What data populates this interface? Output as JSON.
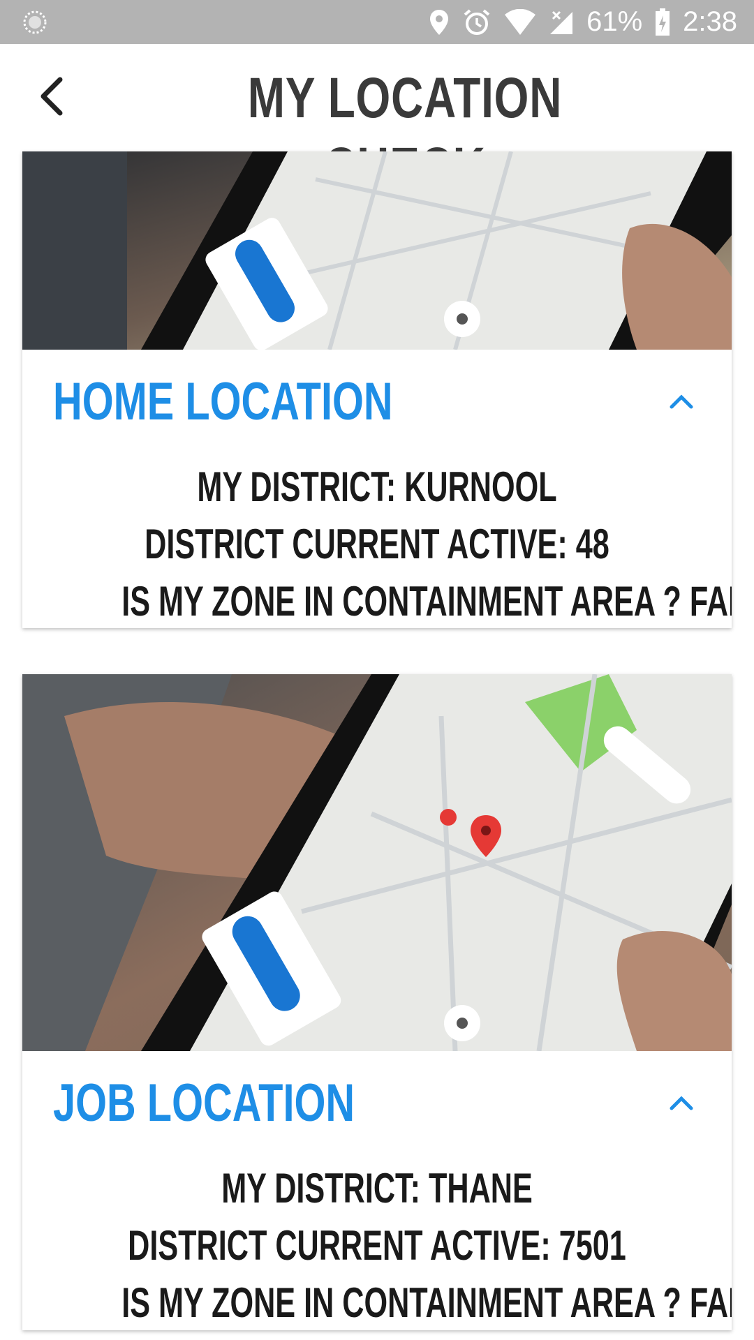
{
  "status_bar": {
    "battery": "61%",
    "time": "2:38"
  },
  "header": {
    "title": "MY LOCATION CHECK"
  },
  "cards": [
    {
      "title": "HOME LOCATION",
      "lines": [
        "MY DISTRICT: KURNOOL",
        "DISTRICT CURRENT ACTIVE: 48",
        "IS MY ZONE IN CONTAINMENT AREA ? FALSE"
      ]
    },
    {
      "title": "JOB LOCATION",
      "lines": [
        "MY DISTRICT: THANE",
        "DISTRICT CURRENT ACTIVE: 7501",
        "IS MY ZONE IN CONTAINMENT AREA ? FALSE"
      ]
    }
  ],
  "colors": {
    "accent": "#1e8ee6",
    "status_bar": "#b3b3b3",
    "title": "#3a3a3a"
  }
}
